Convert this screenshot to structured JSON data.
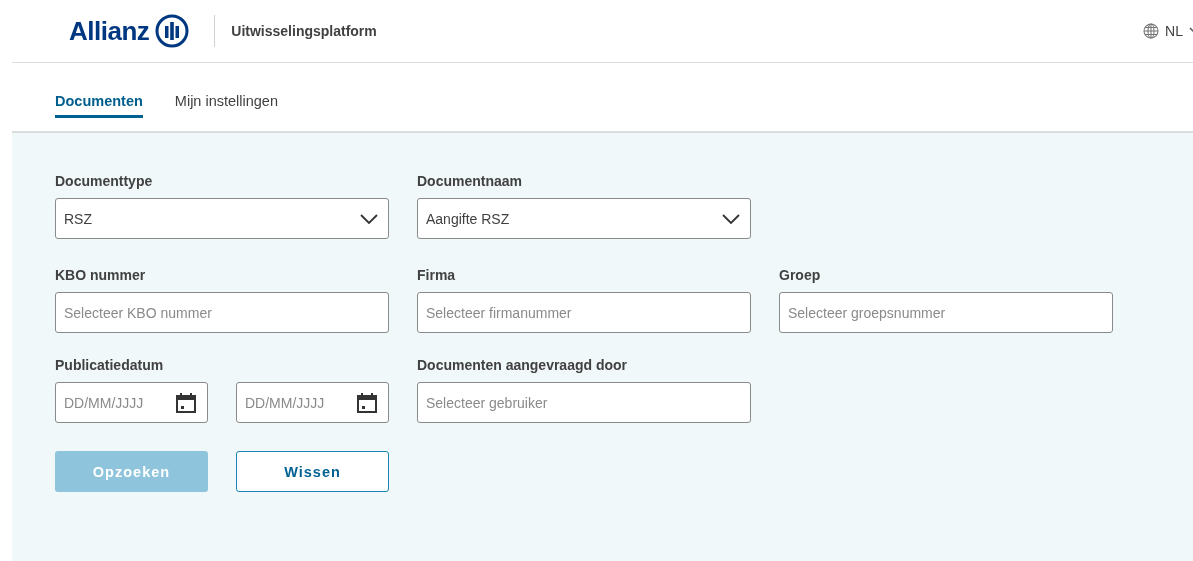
{
  "header": {
    "logo": "Allianz",
    "app_title": "Uitwisselingsplatform",
    "language": "NL"
  },
  "tabs": [
    {
      "label": "Documenten",
      "selected": true
    },
    {
      "label": "Mijn instellingen",
      "selected": false
    }
  ],
  "form": {
    "rows": [
      [
        {
          "kind": "select",
          "label": "Documenttype",
          "value": "RSZ"
        },
        {
          "kind": "select",
          "label": "Documentnaam",
          "value": "Aangifte RSZ"
        }
      ],
      [
        {
          "kind": "text",
          "label": "KBO nummer",
          "placeholder": "Selecteer KBO nummer"
        },
        {
          "kind": "text",
          "label": "Firma",
          "placeholder": "Selecteer firmanummer"
        },
        {
          "kind": "text",
          "label": "Groep",
          "placeholder": "Selecteer groepsnummer"
        }
      ],
      [
        {
          "kind": "date_range",
          "label": "Publicatiedatum",
          "placeholders": [
            "DD/MM/JJJJ",
            "DD/MM/JJJJ"
          ]
        },
        {
          "kind": "text",
          "label": "Documenten aangevraagd door",
          "placeholder": "Selecteer gebruiker"
        }
      ]
    ]
  },
  "buttons": [
    {
      "label": "Opzoeken",
      "kind": "primary",
      "disabled": true
    },
    {
      "label": "Wissen",
      "kind": "secondary",
      "disabled": false
    }
  ]
}
